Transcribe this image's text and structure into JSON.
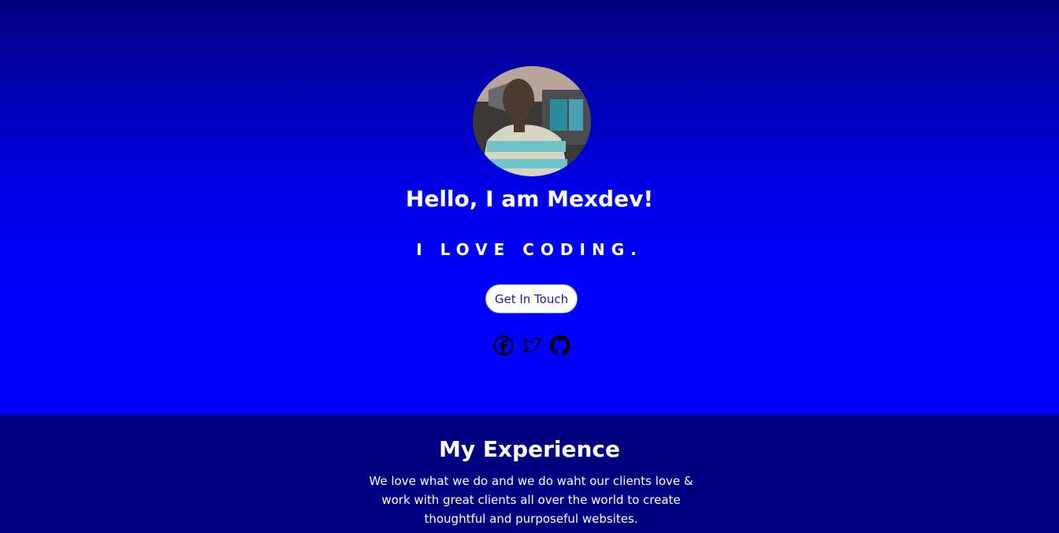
{
  "hero": {
    "greeting": "Hello, I am Mexdev!",
    "tagline": "I LOVE CODING.",
    "cta_label": "Get In Touch",
    "social": [
      {
        "name": "facebook-icon"
      },
      {
        "name": "twitter-icon"
      },
      {
        "name": "github-icon"
      }
    ]
  },
  "experience": {
    "title": "My Experience",
    "description": "We love what we do and we do waht our clients love & work with great clients all over the world to create thoughtful and purposeful websites."
  },
  "colors": {
    "hero_top": "#000080",
    "hero_bottom": "#0000ff",
    "section_bg": "#000080",
    "button_bg": "#ffffff",
    "button_text": "#1a1aa6"
  }
}
